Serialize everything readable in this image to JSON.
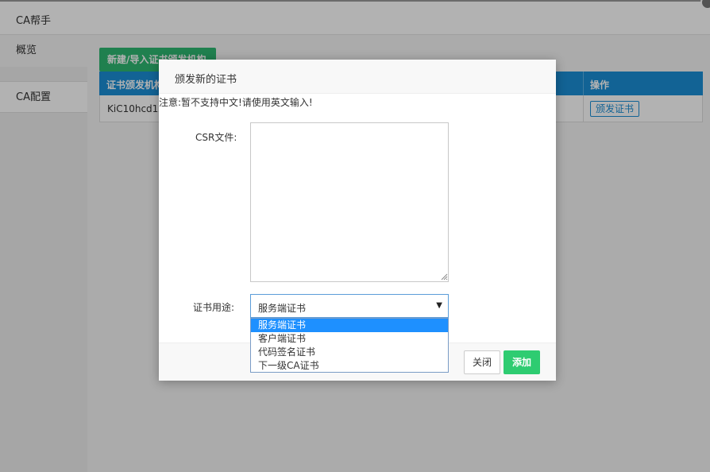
{
  "window": {
    "title": "CA帮手"
  },
  "sidebar": {
    "items": [
      {
        "label": "概览"
      },
      {
        "label": "CA配置"
      }
    ]
  },
  "main": {
    "new_button_label": "新建/导入证书颁发机构",
    "table": {
      "headers": [
        "证书颁发机构",
        "操作"
      ],
      "rows": [
        {
          "name": "KiC10hcd1xl",
          "action_label": "颁发证书"
        }
      ]
    }
  },
  "modal": {
    "title": "颁发新的证书",
    "note": "注意:暂不支持中文!请使用英文输入!",
    "csr_label": "CSR文件:",
    "csr_value": "",
    "usage_label": "证书用途:",
    "usage_selected": "服务端证书",
    "usage_options": [
      "服务端证书",
      "客户端证书",
      "代码签名证书",
      "下一级CA证书"
    ],
    "close_label": "关闭",
    "add_label": "添加"
  },
  "colors": {
    "primary_blue": "#1b8fd6",
    "green": "#2ecc71",
    "selected_option": "#1e90ff"
  }
}
